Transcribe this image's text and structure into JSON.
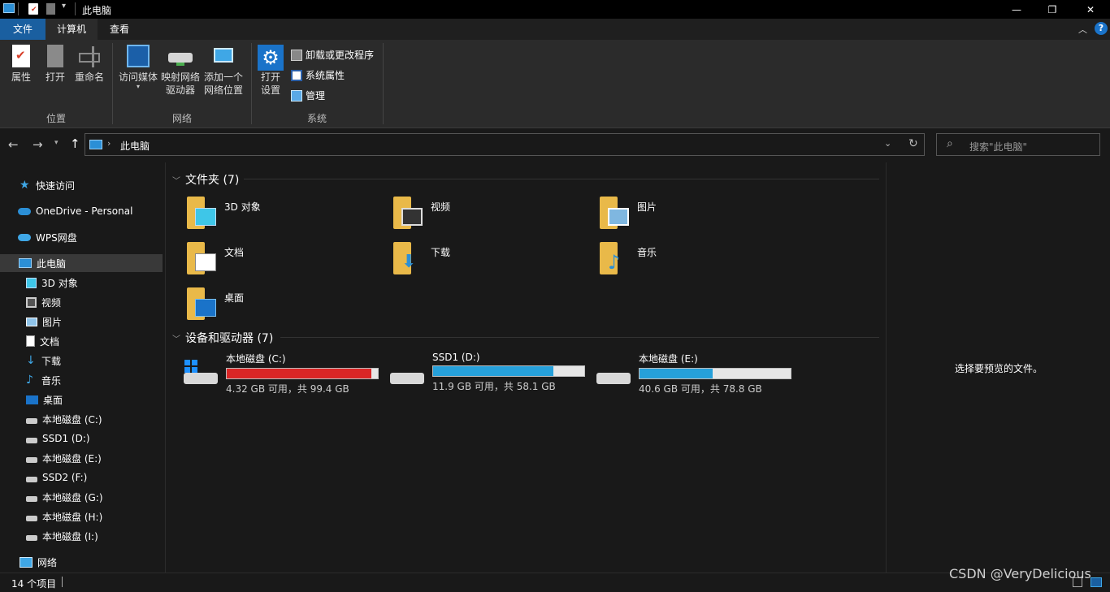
{
  "window": {
    "title": "此电脑",
    "minimize": "—",
    "maximize": "❐",
    "close": "✕"
  },
  "tabs": [
    {
      "label": "文件"
    },
    {
      "label": "计算机"
    },
    {
      "label": "查看"
    }
  ],
  "ribbon": {
    "location_group": "位置",
    "properties": "属性",
    "open": "打开",
    "rename": "重命名",
    "network_group": "网络",
    "access_media": "访问媒体",
    "map_drive_1": "映射网络",
    "map_drive_2": "驱动器",
    "add_location_1": "添加一个",
    "add_location_2": "网络位置",
    "system_group": "系统",
    "open_settings_1": "打开",
    "open_settings_2": "设置",
    "uninstall": "卸载或更改程序",
    "system_props": "系统属性",
    "manage": "管理"
  },
  "address": {
    "path": "此电脑",
    "search_placeholder": "搜索\"此电脑\""
  },
  "nav": {
    "quick_access": "快速访问",
    "onedrive": "OneDrive - Personal",
    "wps": "WPS网盘",
    "this_pc": "此电脑",
    "items": [
      {
        "label": "3D 对象",
        "icon": "cube-icon"
      },
      {
        "label": "视频",
        "icon": "video-icon"
      },
      {
        "label": "图片",
        "icon": "picture-icon"
      },
      {
        "label": "文档",
        "icon": "document-icon"
      },
      {
        "label": "下载",
        "icon": "download-icon"
      },
      {
        "label": "音乐",
        "icon": "music-icon"
      },
      {
        "label": "桌面",
        "icon": "desktop-icon"
      },
      {
        "label": "本地磁盘 (C:)",
        "icon": "drive-icon"
      },
      {
        "label": "SSD1 (D:)",
        "icon": "drive-icon"
      },
      {
        "label": "本地磁盘 (E:)",
        "icon": "drive-icon"
      },
      {
        "label": "SSD2 (F:)",
        "icon": "drive-icon"
      },
      {
        "label": "本地磁盘 (G:)",
        "icon": "drive-icon"
      },
      {
        "label": "本地磁盘 (H:)",
        "icon": "drive-icon"
      },
      {
        "label": "本地磁盘 (I:)",
        "icon": "drive-icon"
      }
    ],
    "network": "网络"
  },
  "content": {
    "folders_header": "文件夹 (7)",
    "folders": [
      {
        "label": "3D 对象",
        "badge": "cube"
      },
      {
        "label": "视频",
        "badge": "video"
      },
      {
        "label": "图片",
        "badge": "picture"
      },
      {
        "label": "文档",
        "badge": "document"
      },
      {
        "label": "下载",
        "badge": "download"
      },
      {
        "label": "音乐",
        "badge": "music"
      },
      {
        "label": "桌面",
        "badge": "desktop"
      }
    ],
    "drives_header": "设备和驱动器 (7)",
    "drives": [
      {
        "label": "本地磁盘 (C:)",
        "info": "4.32 GB 可用，共 99.4 GB",
        "used_fraction": 0.957,
        "color": "#da2626",
        "windows": true
      },
      {
        "label": "SSD1 (D:)",
        "info": "11.9 GB 可用，共 58.1 GB",
        "used_fraction": 0.795,
        "color": "#26a0da",
        "windows": false
      },
      {
        "label": "本地磁盘 (E:)",
        "info": "40.6 GB 可用，共 78.8 GB",
        "used_fraction": 0.485,
        "color": "#26a0da",
        "windows": false
      }
    ]
  },
  "preview": {
    "message": "选择要预览的文件。"
  },
  "status": {
    "count": "14 个项目"
  },
  "watermark": "CSDN @VeryDelicious"
}
